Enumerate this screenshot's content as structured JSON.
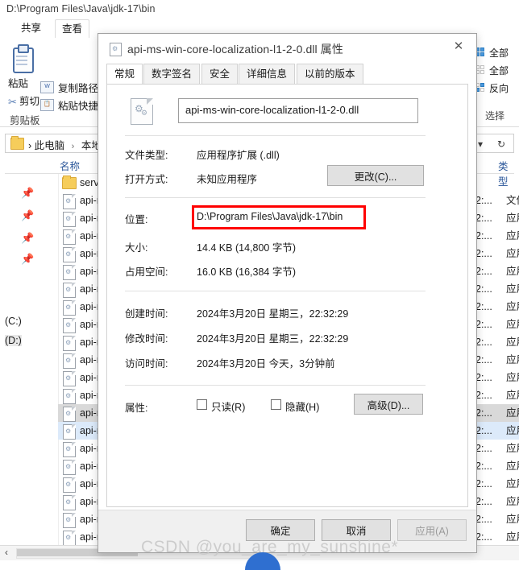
{
  "explorer": {
    "address_path": "D:\\Program Files\\Java\\jdk-17\\bin",
    "ribbon_tabs": [
      {
        "label": "共享",
        "selected": false
      },
      {
        "label": "查看",
        "selected": true
      }
    ],
    "clipboard": {
      "paste_label": "粘贴",
      "copy_path_label": "复制路径",
      "paste_shortcut_label": "粘贴快捷方",
      "cut_label": "剪切",
      "group_caption": "剪贴板"
    },
    "select_group": {
      "select_all_label": "全部",
      "select_none_label": "全部",
      "invert_label": "反向",
      "group_caption": "选择"
    },
    "breadcrumb": {
      "items": [
        "此电脑",
        "本地"
      ],
      "separator": "›",
      "dropdown_icon": "chevron-down-icon",
      "refresh_icon": "refresh-icon"
    },
    "columns": {
      "name": "名称",
      "type": "类型"
    },
    "nav_drives": [
      {
        "label": "(C:)",
        "selected": false
      },
      {
        "label": "(D:)",
        "selected": true
      }
    ],
    "rows": [
      {
        "name": "server",
        "kind": "folder",
        "date": "",
        "type": "",
        "state": ""
      },
      {
        "name": "api-ms-w",
        "kind": "file",
        "date": "2:...",
        "type": "文件",
        "state": ""
      },
      {
        "name": "api-ms-w",
        "kind": "file",
        "date": "2:...",
        "type": "应用",
        "state": ""
      },
      {
        "name": "api-ms-w",
        "kind": "file",
        "date": "2:...",
        "type": "应用",
        "state": ""
      },
      {
        "name": "api-ms-w",
        "kind": "file",
        "date": "2:...",
        "type": "应用",
        "state": ""
      },
      {
        "name": "api-ms-w",
        "kind": "file",
        "date": "2:...",
        "type": "应用",
        "state": ""
      },
      {
        "name": "api-ms-w",
        "kind": "file",
        "date": "2:...",
        "type": "应用",
        "state": ""
      },
      {
        "name": "api-ms-w",
        "kind": "file",
        "date": "2:...",
        "type": "应用",
        "state": ""
      },
      {
        "name": "api-ms-w",
        "kind": "file",
        "date": "2:...",
        "type": "应用",
        "state": ""
      },
      {
        "name": "api-ms-w",
        "kind": "file",
        "date": "2:...",
        "type": "应用",
        "state": ""
      },
      {
        "name": "api-ms-w",
        "kind": "file",
        "date": "2:...",
        "type": "应用",
        "state": ""
      },
      {
        "name": "api-ms-w",
        "kind": "file",
        "date": "2:...",
        "type": "应用",
        "state": ""
      },
      {
        "name": "api-ms-w",
        "kind": "file",
        "date": "2:...",
        "type": "应用",
        "state": ""
      },
      {
        "name": "api-ms-w",
        "kind": "file",
        "date": "2:...",
        "type": "应用",
        "state": "hover"
      },
      {
        "name": "api-ms-w",
        "kind": "file",
        "date": "2:...",
        "type": "应用",
        "state": "selected"
      },
      {
        "name": "api-ms-w",
        "kind": "file",
        "date": "2:...",
        "type": "应用",
        "state": ""
      },
      {
        "name": "api-ms-w",
        "kind": "file",
        "date": "2:...",
        "type": "应用",
        "state": ""
      },
      {
        "name": "api-ms-w",
        "kind": "file",
        "date": "2:...",
        "type": "应用",
        "state": ""
      },
      {
        "name": "api-ms-w",
        "kind": "file",
        "date": "2:...",
        "type": "应用",
        "state": ""
      },
      {
        "name": "api-ms-w",
        "kind": "file",
        "date": "2:...",
        "type": "应用",
        "state": ""
      },
      {
        "name": "api-ms-w",
        "kind": "file",
        "date": "2:...",
        "type": "应用",
        "state": ""
      }
    ],
    "status_collapse_icon": "‹"
  },
  "dialog": {
    "title": "api-ms-win-core-localization-l1-2-0.dll 属性",
    "close_icon": "close-icon",
    "tabs": [
      {
        "label": "常规",
        "active": true
      },
      {
        "label": "数字签名",
        "active": false
      },
      {
        "label": "安全",
        "active": false
      },
      {
        "label": "详细信息",
        "active": false
      },
      {
        "label": "以前的版本",
        "active": false
      }
    ],
    "filename_value": "api-ms-win-core-localization-l1-2-0.dll",
    "fields": [
      {
        "label": "文件类型:",
        "value": "应用程序扩展 (.dll)"
      },
      {
        "label": "打开方式:",
        "value": "未知应用程序"
      },
      {
        "label": "位置:",
        "value": "D:\\Program Files\\Java\\jdk-17\\bin",
        "highlighted": true
      },
      {
        "label": "大小:",
        "value": "14.4 KB (14,800 字节)"
      },
      {
        "label": "占用空间:",
        "value": "16.0 KB (16,384 字节)"
      },
      {
        "label": "创建时间:",
        "value": "2024年3月20日 星期三，22:32:29"
      },
      {
        "label": "修改时间:",
        "value": "2024年3月20日 星期三，22:32:29"
      },
      {
        "label": "访问时间:",
        "value": "2024年3月20日 今天，3分钟前"
      }
    ],
    "change_button": "更改(C)...",
    "attributes": {
      "label": "属性:",
      "readonly_label": "只读(R)",
      "readonly_checked": false,
      "hidden_label": "隐藏(H)",
      "hidden_checked": false,
      "advanced_button": "高级(D)..."
    },
    "footer": {
      "ok": "确定",
      "cancel": "取消",
      "apply": "应用(A)",
      "apply_disabled": true
    },
    "highlight_color": "#ff0000"
  },
  "watermark": "CSDN @you_are_my_sunshine*"
}
